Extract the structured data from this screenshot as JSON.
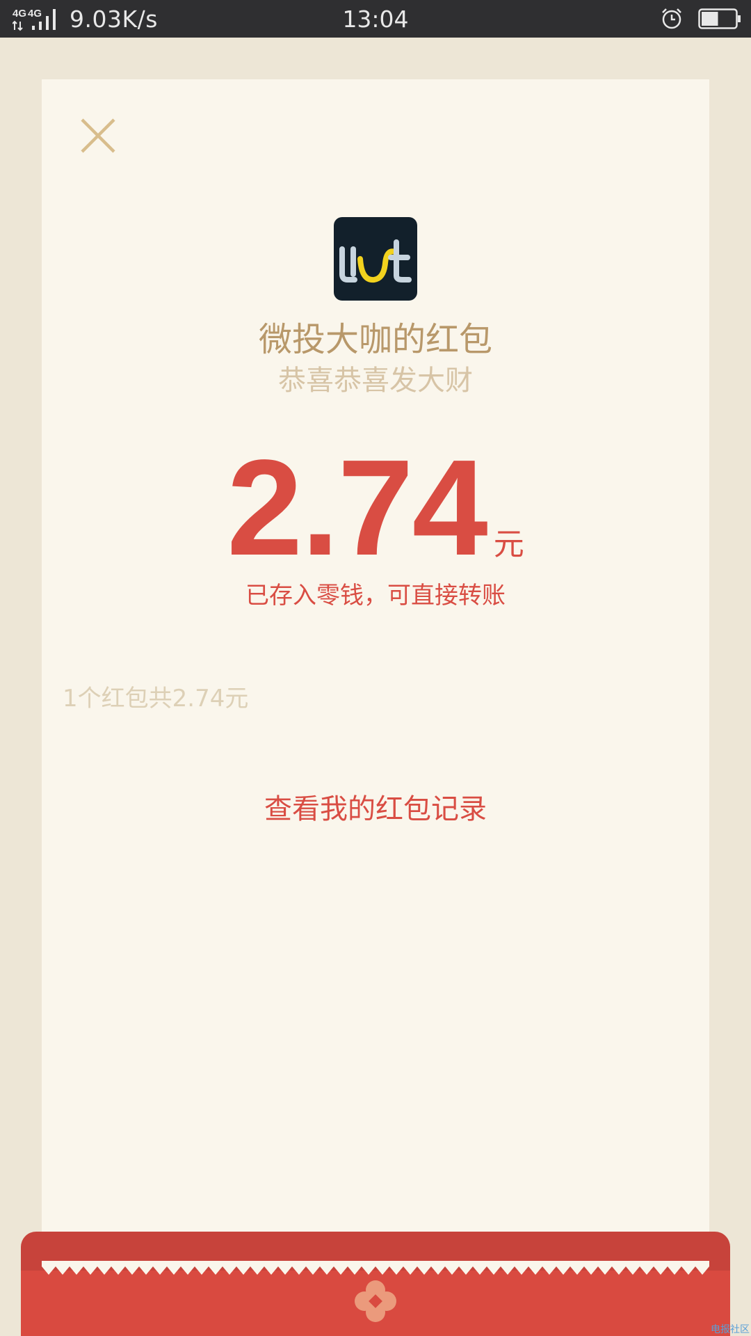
{
  "status_bar": {
    "network": "4G 4G",
    "speed": "9.03K/s",
    "time": "13:04",
    "battery_level_percent": 50
  },
  "card": {
    "sender": "微投大咖的红包",
    "greeting": "恭喜恭喜发大财",
    "amount": "2.74",
    "unit": "元",
    "note": "已存入零钱，可直接转账",
    "summary": "1个红包共2.74元",
    "record_link": "查看我的红包记录"
  },
  "icons": {
    "close": "close-icon",
    "logo": "app-logo",
    "alarm": "alarm-icon",
    "battery": "battery-icon"
  },
  "colors": {
    "accent_red": "#d94d43",
    "gold_text": "#b8986a",
    "card_bg": "#faf6ec",
    "page_bg": "#ede6d6",
    "logo_bg": "#12202b",
    "logo_yellow": "#f2d21e"
  },
  "watermark": "电报社区"
}
